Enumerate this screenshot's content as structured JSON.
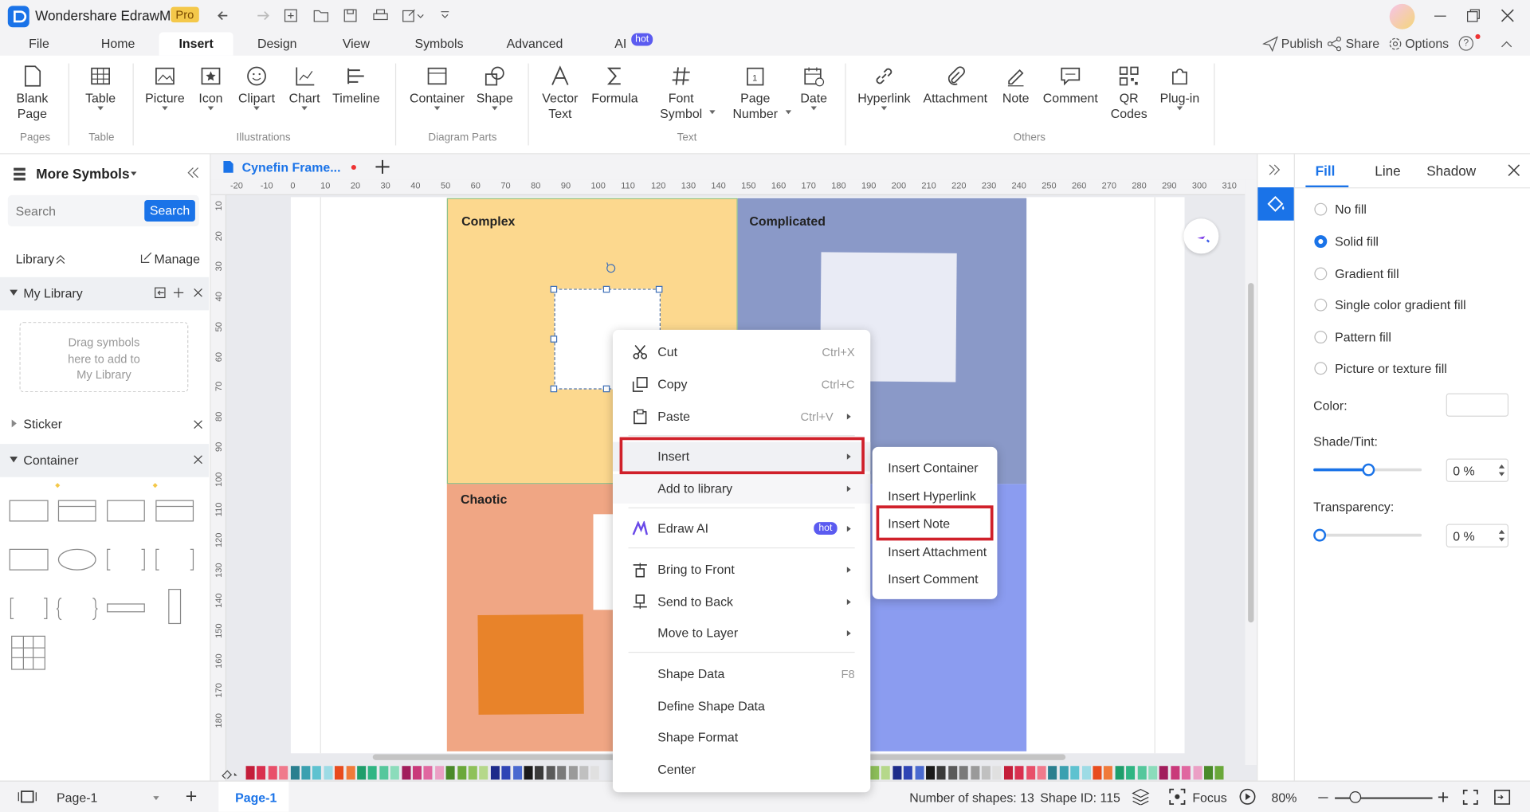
{
  "app": {
    "title": "Wondershare EdrawMax",
    "badge": "Pro"
  },
  "menu": {
    "tabs": [
      "File",
      "Home",
      "Insert",
      "Design",
      "View",
      "Symbols",
      "Advanced",
      "AI"
    ],
    "ai_badge": "hot",
    "active": "Insert",
    "right": {
      "publish": "Publish",
      "share": "Share",
      "options": "Options"
    }
  },
  "ribbon": {
    "buttons": {
      "blank_page": [
        "Blank",
        "Page"
      ],
      "table": "Table",
      "picture": "Picture",
      "icon": "Icon",
      "clipart": "Clipart",
      "chart": "Chart",
      "timeline": "Timeline",
      "container": "Container",
      "shape": "Shape",
      "vector_text": [
        "Vector",
        "Text"
      ],
      "formula": "Formula",
      "font_symbol": [
        "Font",
        "Symbol"
      ],
      "page_number": [
        "Page",
        "Number"
      ],
      "date": "Date",
      "hyperlink": "Hyperlink",
      "attachment": "Attachment",
      "note": "Note",
      "comment": "Comment",
      "qr_codes": [
        "QR",
        "Codes"
      ],
      "plugin": "Plug-in"
    },
    "groups": {
      "pages": "Pages",
      "table": "Table",
      "illustrations": "Illustrations",
      "diagram_parts": "Diagram Parts",
      "text": "Text",
      "others": "Others"
    }
  },
  "left_panel": {
    "title": "More Symbols",
    "search_placeholder": "Search",
    "search_button": "Search",
    "library_label": "Library",
    "manage": "Manage",
    "my_library": "My Library",
    "drag_hint": [
      "Drag symbols",
      "here to add to",
      "My Library"
    ],
    "sticker": "Sticker",
    "container": "Container"
  },
  "document": {
    "tab_name": "Cynefin Frame...",
    "ruler_h": [
      "-20",
      "-10",
      "0",
      "10",
      "20",
      "30",
      "40",
      "50",
      "60",
      "70",
      "80",
      "90",
      "100",
      "110",
      "120",
      "130",
      "140",
      "150",
      "160",
      "170",
      "180",
      "190",
      "200",
      "210",
      "220",
      "230",
      "240",
      "250",
      "260",
      "270",
      "280",
      "290",
      "300",
      "310"
    ],
    "ruler_v": [
      "10",
      "20",
      "30",
      "40",
      "50",
      "60",
      "70",
      "80",
      "90",
      "100",
      "110",
      "120",
      "130",
      "140",
      "150",
      "160",
      "170",
      "180"
    ],
    "quadrants": {
      "complex": "Complex",
      "complicated": "Complicated",
      "chaotic": "Chaotic"
    }
  },
  "context_menu": {
    "items": [
      {
        "label": "Cut",
        "shortcut": "Ctrl+X",
        "icon": "scissors-icon"
      },
      {
        "label": "Copy",
        "shortcut": "Ctrl+C",
        "icon": "copy-icon"
      },
      {
        "label": "Paste",
        "shortcut": "Ctrl+V",
        "icon": "paste-icon"
      },
      {
        "label": "Insert"
      },
      {
        "label": "Add to library"
      },
      {
        "label": "Edraw AI",
        "badge": "hot",
        "icon": "edraw-ai-icon"
      },
      {
        "label": "Bring to Front",
        "icon": "bring-front-icon"
      },
      {
        "label": "Send to Back",
        "icon": "send-back-icon"
      },
      {
        "label": "Move to Layer"
      },
      {
        "label": "Shape Data",
        "shortcut": "F8"
      },
      {
        "label": "Define Shape Data"
      },
      {
        "label": "Shape Format"
      },
      {
        "label": "Center"
      }
    ],
    "highlighted": "Insert"
  },
  "submenu": {
    "items": [
      "Insert Container",
      "Insert Hyperlink",
      "Insert Note",
      "Insert Attachment",
      "Insert Comment"
    ],
    "highlighted": "Insert Note"
  },
  "right_panel": {
    "tabs": [
      "Fill",
      "Line",
      "Shadow"
    ],
    "active_tab": "Fill",
    "fill_options": [
      "No fill",
      "Solid fill",
      "Gradient fill",
      "Single color gradient fill",
      "Pattern fill",
      "Picture or texture fill"
    ],
    "selected_fill": "Solid fill",
    "color_label": "Color:",
    "shade_label": "Shade/Tint:",
    "shade_value": "0 %",
    "shade_level": 0.5,
    "transparency_label": "Transparency:",
    "transparency_value": "0 %",
    "transparency_level": 0
  },
  "status": {
    "page_select": "Page-1",
    "page_tab": "Page-1",
    "shapes": "Number of shapes: 13",
    "shape_id": "Shape ID: 115",
    "focus": "Focus",
    "zoom": "80%"
  },
  "colors": {
    "accent": "#1a73e8",
    "complex": "#fcd88e",
    "complicated": "#8a99c8",
    "chaotic": "#f0a684",
    "clear": "#8b9cf0",
    "note_orange": "#e8832a",
    "red_highlight": "#d0202a",
    "palette": [
      "#c41e3a",
      "#d9304f",
      "#e8506a",
      "#f07a8c",
      "#2a7f8f",
      "#3aa0b0",
      "#5ec2d0",
      "#9ddbe5",
      "#e84c1e",
      "#f07a3a",
      "#1e9e6b",
      "#2fb583",
      "#55c79c",
      "#8bdcbb",
      "#a11d5c",
      "#c9397a",
      "#e067a0",
      "#eba0c5",
      "#4a8a2a",
      "#6aa83a",
      "#8ec15a",
      "#b5d88a",
      "#1c2a8a",
      "#2f45b5",
      "#4a6ad0",
      "#1a1a1a",
      "#3a3a3a",
      "#5a5a5a",
      "#7a7a7a",
      "#9a9a9a",
      "#c0c0c0",
      "#e0e0e0"
    ]
  }
}
